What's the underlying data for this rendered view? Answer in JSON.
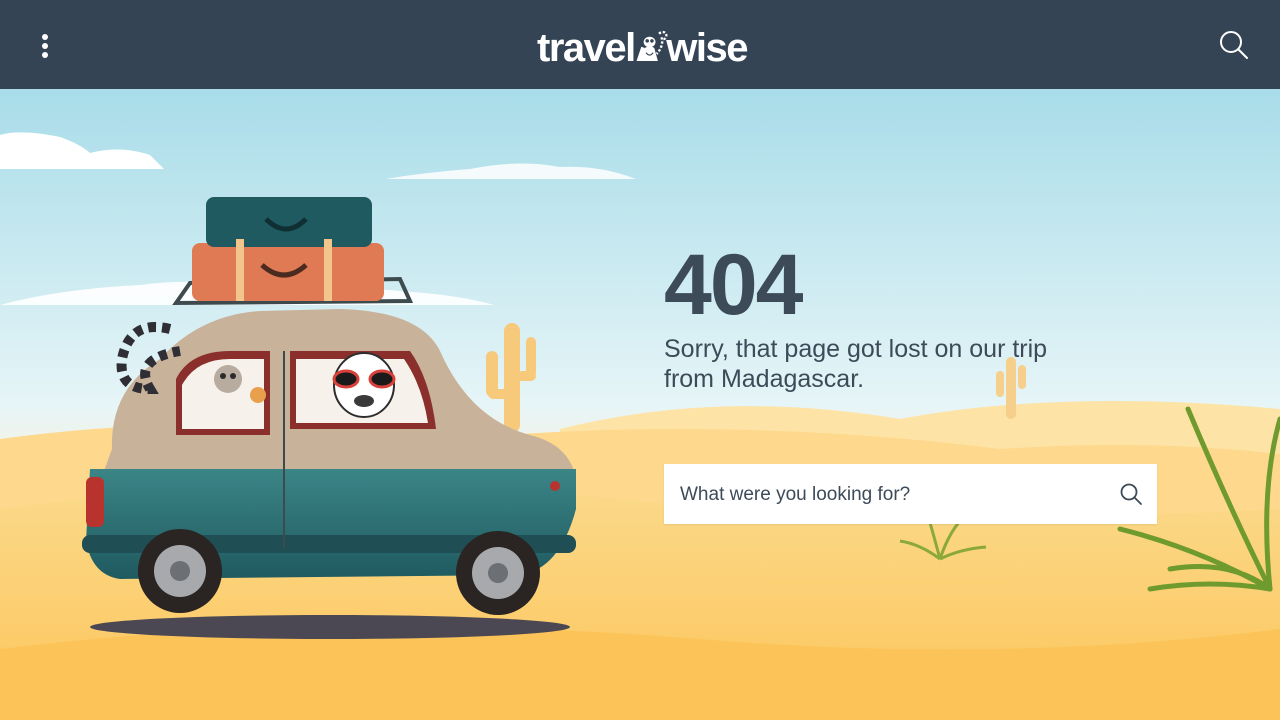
{
  "header": {
    "brand_left": "travel",
    "brand_right": "wise",
    "menu_icon": "kebab-menu-icon",
    "search_icon": "search-icon",
    "background_color": "#344455"
  },
  "error": {
    "code": "404",
    "message": "Sorry, that page got lost on our trip from Madagascar."
  },
  "search": {
    "placeholder": "What were you looking for?",
    "value": "",
    "submit_icon": "search-icon"
  },
  "colors": {
    "text": "#3d4b59",
    "sky_top": "#a8dce9",
    "sand": "#fcc95a"
  }
}
